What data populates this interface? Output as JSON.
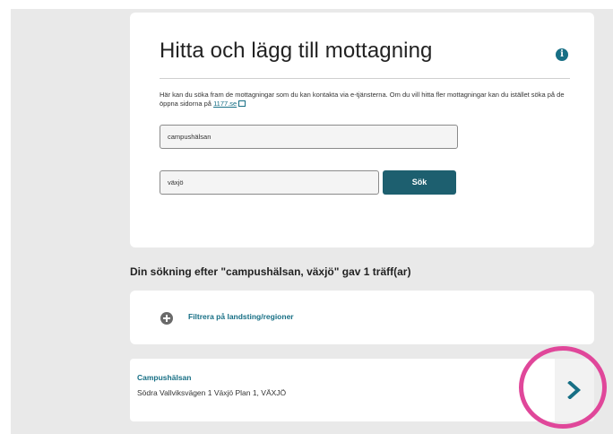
{
  "search": {
    "title": "Hitta och lägg till mottagning",
    "info_icon": "i",
    "description": "Här kan du söka fram de mottagningar som du kan kontakta via e-tjänsterna. Om du vill hitta fler mottagningar kan du istället söka på de öppna sidorna på",
    "link_text": "1177.se",
    "name_value": "campushälsan",
    "city_value": "växjö",
    "button_label": "Sök"
  },
  "results": {
    "heading": "Din sökning efter \"campushälsan, växjö\" gav 1 träff(ar)",
    "filter_label": "Filtrera på landsting/regioner",
    "items": [
      {
        "name": "Campushälsan",
        "address": "Södra Vallviksvägen 1 Växjö Plan 1, VÄXJÖ"
      }
    ]
  },
  "colors": {
    "accent": "#176f85",
    "button": "#1d5f6f",
    "highlight": "#e0479a",
    "background": "#e9e9e9"
  },
  "icons": {
    "info": "info-icon",
    "external": "external-link-icon",
    "filter": "plus-circle-icon",
    "open": "chevron-right-icon"
  }
}
